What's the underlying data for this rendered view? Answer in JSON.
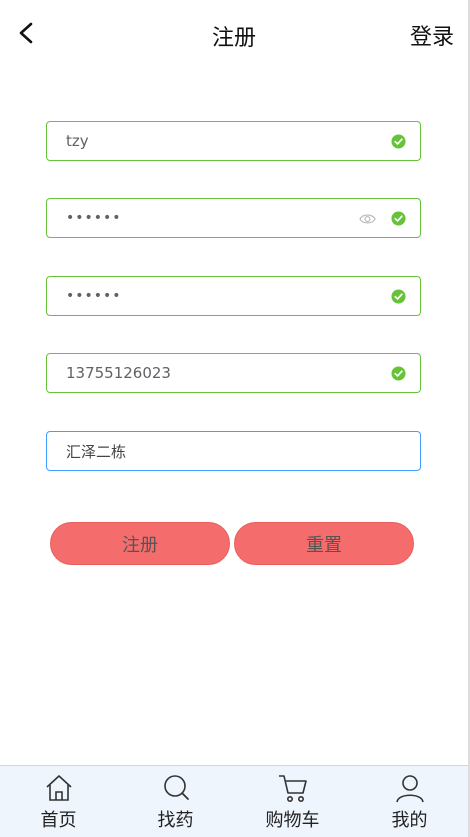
{
  "header": {
    "back_icon": "chevron-left-icon",
    "title": "注册",
    "login_label": "登录"
  },
  "form": {
    "username": {
      "value": "tzy",
      "status": "valid"
    },
    "password": {
      "value": "••••••",
      "status": "valid",
      "toggle_icon": "eye-icon"
    },
    "confirm_password": {
      "value": "••••••",
      "status": "valid"
    },
    "phone": {
      "value": "13755126023",
      "status": "valid"
    },
    "address": {
      "value": "汇泽二栋",
      "status": "focused"
    }
  },
  "buttons": {
    "register_label": "注册",
    "reset_label": "重置"
  },
  "tabbar": {
    "items": [
      {
        "label": "首页",
        "icon": "home-icon"
      },
      {
        "label": "找药",
        "icon": "search-icon"
      },
      {
        "label": "购物车",
        "icon": "cart-icon"
      },
      {
        "label": "我的",
        "icon": "user-icon"
      }
    ]
  },
  "colors": {
    "valid_border": "#67c23a",
    "focus_border": "#409eff",
    "button_bg": "#f56c6c",
    "tabbar_bg": "#eef5fc"
  }
}
